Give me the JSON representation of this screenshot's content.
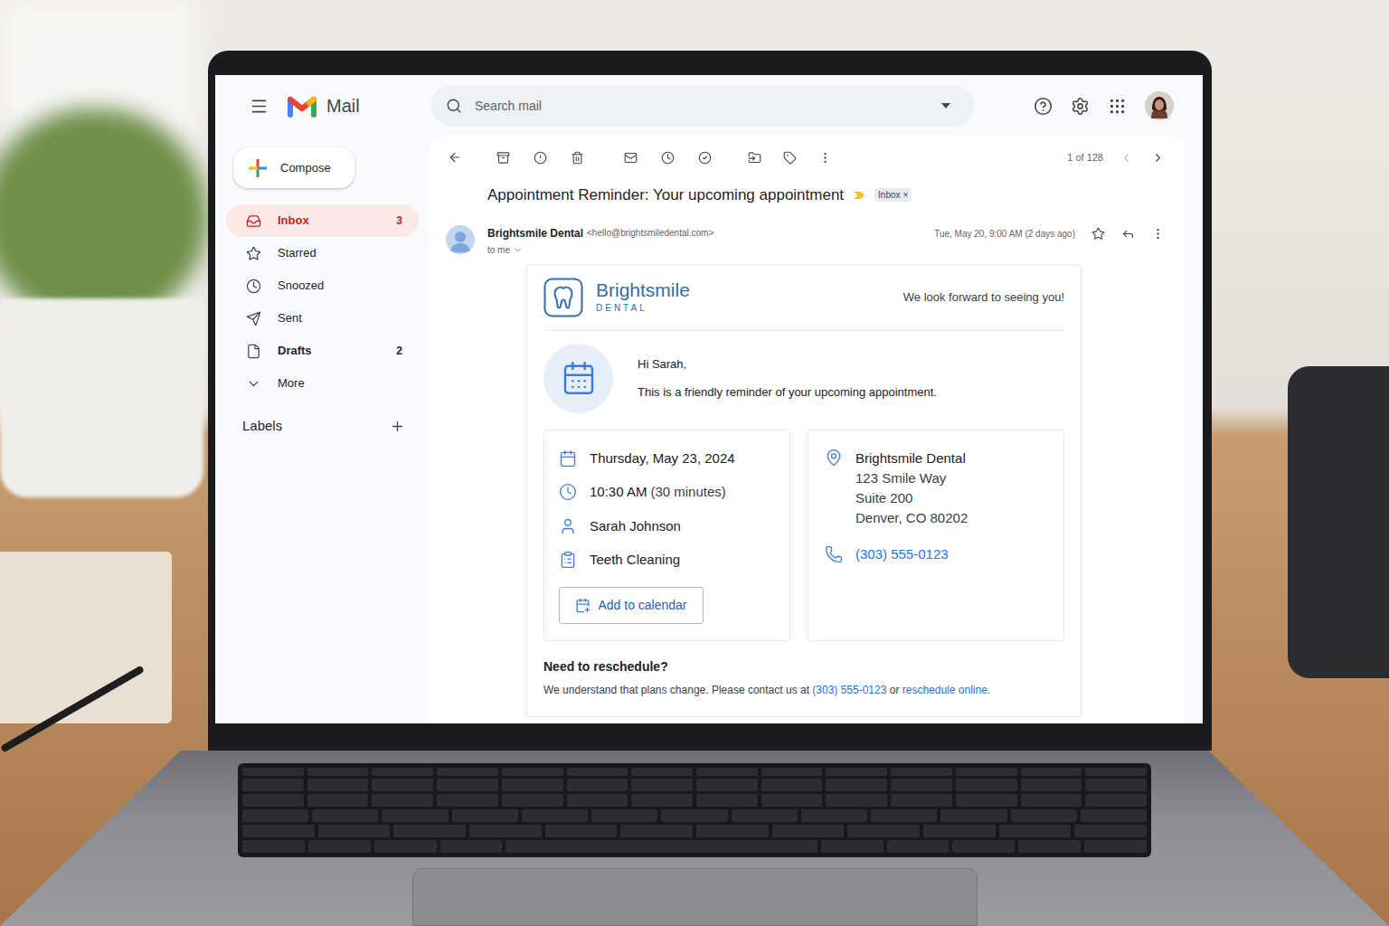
{
  "app": {
    "name": "Mail"
  },
  "search": {
    "placeholder": "Search mail"
  },
  "compose": {
    "label": "Compose"
  },
  "sidebar": {
    "items": [
      {
        "label": "Inbox",
        "count": "3",
        "selected": true,
        "bold": true
      },
      {
        "label": "Starred",
        "count": "",
        "selected": false,
        "bold": false
      },
      {
        "label": "Snoozed",
        "count": "",
        "selected": false,
        "bold": false
      },
      {
        "label": "Sent",
        "count": "",
        "selected": false,
        "bold": false
      },
      {
        "label": "Drafts",
        "count": "2",
        "selected": false,
        "bold": true
      },
      {
        "label": "More",
        "count": "",
        "selected": false,
        "bold": false
      }
    ],
    "labels_heading": "Labels"
  },
  "toolbar": {
    "pagination": "1 of 128"
  },
  "email": {
    "subject": "Appointment Reminder: Your upcoming appointment",
    "important": true,
    "label_chip": "Inbox",
    "chip_close": "×",
    "sender_name": "Brightsmile Dental",
    "sender_email": "<hello@brightsmiledental.com>",
    "to": "to me",
    "date": "Tue, May 20, 9:00 AM (2 days ago)",
    "starred": false
  },
  "card": {
    "brand": "Brightsmile",
    "brand_sub": "DENTAL",
    "tagline": "We look forward to seeing you!",
    "greeting": "Hi Sarah,",
    "intro": "This is a friendly reminder of your upcoming appointment.",
    "details": [
      {
        "kind": "date",
        "text": "Thursday, May 23, 2024",
        "note": ""
      },
      {
        "kind": "time",
        "text": "10:30 AM",
        "note": "(30 minutes)"
      },
      {
        "kind": "person",
        "text": "Sarah Johnson",
        "note": ""
      },
      {
        "kind": "service",
        "text": "Teeth Cleaning",
        "note": ""
      }
    ],
    "calendar_button": "Add to calendar",
    "location": {
      "name": "Brightsmile Dental",
      "lines": [
        "123 Smile Way",
        "Suite 200",
        "Denver, CO 80202"
      ],
      "phone": "(303) 555-0123"
    },
    "reschedule": {
      "heading": "Need to reschedule?",
      "text": "We understand that plans change. Please contact us at",
      "phone": "(303) 555-0123",
      "or": "or",
      "link": "reschedule online."
    }
  }
}
